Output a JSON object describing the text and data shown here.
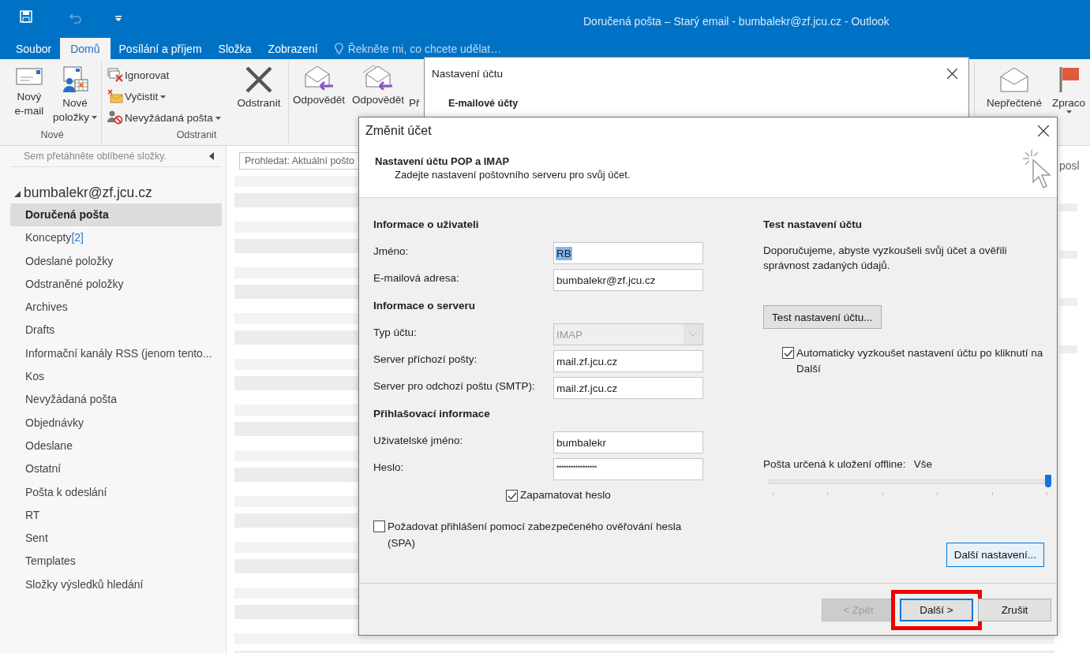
{
  "window": {
    "title": "Doručená pošta – Starý email - bumbalekr@zf.jcu.cz - Outlook"
  },
  "tabs": [
    {
      "label": "Soubor",
      "selected": false
    },
    {
      "label": "Domů",
      "selected": true
    },
    {
      "label": "Posílání a příjem",
      "selected": false
    },
    {
      "label": "Složka",
      "selected": false
    },
    {
      "label": "Zobrazení",
      "selected": false
    }
  ],
  "tell_me": "Řekněte mi, co chcete udělat…",
  "ribbon": {
    "new_email": {
      "label": "Nový e-mail"
    },
    "new_items": {
      "label": "Nové položky",
      "dropdown": true
    },
    "new_group": "Nové",
    "ignore": {
      "label": "Ignorovat"
    },
    "clean": {
      "label": "Vyčistit",
      "dropdown": true
    },
    "junk": {
      "label": "Nevyžádaná pošta",
      "dropdown": true
    },
    "delete": {
      "label": "Odstranit"
    },
    "delete_group": "Odstranit",
    "reply": {
      "label": "Odpovědět"
    },
    "reply_all": {
      "label": "Odpovědět"
    },
    "forward": {
      "label": "Př"
    },
    "unread": {
      "label": "Nepřečtené"
    },
    "followup": {
      "label": "Zpraco",
      "dropdown": true
    }
  },
  "sidebar": {
    "hint": "Sem přetáhněte oblíbené složky.",
    "account": {
      "label": "bumbalekr@zf.jcu.cz",
      "expanded": true
    },
    "folders": [
      {
        "label": "Doručená pošta",
        "selected": true
      },
      {
        "label": "Koncepty",
        "count": "[2]",
        "selected": false
      },
      {
        "label": "Odeslané položky",
        "selected": false
      },
      {
        "label": "Odstraněné položky",
        "selected": false
      },
      {
        "label": "Archives",
        "selected": false
      },
      {
        "label": "Drafts",
        "selected": false
      },
      {
        "label": "Informační kanály RSS (jenom tento...",
        "selected": false
      },
      {
        "label": "Kos",
        "selected": false
      },
      {
        "label": "Nevyžádaná pošta",
        "selected": false
      },
      {
        "label": "Objednávky",
        "selected": false
      },
      {
        "label": "Odeslane",
        "selected": false
      },
      {
        "label": "Ostatní",
        "selected": false
      },
      {
        "label": "Pošta k odeslání",
        "selected": false
      },
      {
        "label": "RT",
        "selected": false
      },
      {
        "label": "Sent",
        "selected": false
      },
      {
        "label": "Templates",
        "selected": false
      },
      {
        "label": "Složky výsledků hledání",
        "selected": false
      }
    ]
  },
  "message_list": {
    "search": {
      "placeholder": "Prohledat: Aktuální pošto"
    }
  },
  "reading_pane": {
    "header": "posl"
  },
  "account_settings_dialog": {
    "title": "Nastavení účtu",
    "tab": "E-mailové účty"
  },
  "change_account_dialog": {
    "title": "Změnit účet",
    "heading": "Nastavení účtu POP a IMAP",
    "subheading": "Zadejte nastavení poštovního serveru pro svůj účet.",
    "sections": [
      {
        "heading": "Informace o uživateli",
        "fields": [
          {
            "label": "Jméno:",
            "value": "RB",
            "kind": "text",
            "disabled": false,
            "text_selected": true
          },
          {
            "label": "E-mailová adresa:",
            "value": "bumbalekr@zf.jcu.cz",
            "kind": "text",
            "disabled": false,
            "text_selected": false
          }
        ]
      },
      {
        "heading": "Informace o serveru",
        "fields": [
          {
            "label": "Typ účtu:",
            "value": "IMAP",
            "kind": "select",
            "disabled": true,
            "text_selected": false
          },
          {
            "label": "Server příchozí pošty:",
            "value": "mail.zf.jcu.cz",
            "kind": "text",
            "disabled": false,
            "text_selected": false
          },
          {
            "label": "Server pro odchozí poštu (SMTP):",
            "value": "mail.zf.jcu.cz",
            "kind": "text",
            "disabled": false,
            "text_selected": false
          }
        ]
      },
      {
        "heading": "Přihlašovací informace",
        "fields": [
          {
            "label": "Uživatelské jméno:",
            "value": "bumbalekr",
            "kind": "text",
            "disabled": false,
            "text_selected": false
          },
          {
            "label": "Heslo:",
            "value": "*****************",
            "kind": "password",
            "disabled": false,
            "text_selected": false
          }
        ]
      }
    ],
    "remember_password": {
      "label": "Zapamatovat heslo",
      "checked": true
    },
    "spa": {
      "label": "Požadovat přihlášení pomocí zabezpečeného ověřování hesla (SPA)",
      "checked": false
    },
    "test": {
      "heading": "Test nastavení účtu",
      "text": "Doporučujeme, abyste vyzkoušeli svůj účet a ověřili správnost zadaných údajů.",
      "button": "Test nastavení účtu...",
      "auto_test": {
        "label": "Automaticky vyzkoušet nastavení účtu po kliknutí na Další",
        "checked": true
      }
    },
    "offline": {
      "label": "Pošta určená k uložení offline:",
      "value": "Vše",
      "level": 1
    },
    "more_settings": "Další nastavení...",
    "buttons": [
      {
        "label": "< Zpět",
        "disabled": true,
        "default": false,
        "highlighted": false
      },
      {
        "label": "Další >",
        "disabled": false,
        "default": true,
        "highlighted": true
      },
      {
        "label": "Zrušit",
        "disabled": false,
        "default": false,
        "highlighted": false
      }
    ]
  }
}
